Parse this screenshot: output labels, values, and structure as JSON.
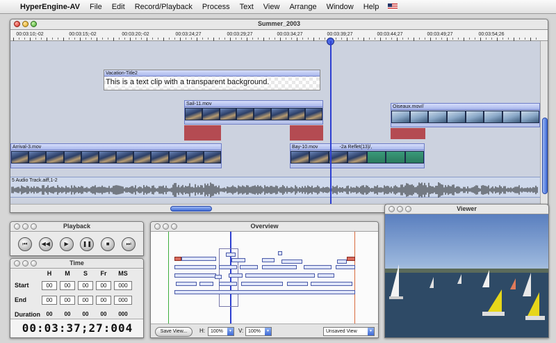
{
  "menubar": {
    "apple_glyph": "",
    "app_name": "HyperEngine-AV",
    "items": [
      "File",
      "Edit",
      "Record/Playback",
      "Process",
      "Text",
      "View",
      "Arrange",
      "Window",
      "Help"
    ]
  },
  "main_window": {
    "title": "Summer_2003",
    "ruler_labels": [
      "00:03:10;-02",
      "00:03:15;-02",
      "00:03:20;-02",
      "00:03:24;27",
      "00:03:29;27",
      "00:03:34;27",
      "00:03:39;27",
      "00:03:44;27",
      "00:03:49;27",
      "00:03:54;26"
    ],
    "text_clip": {
      "name": "Vacation-Title2",
      "text": "This is a text clip with a transparent background."
    },
    "clips": {
      "sail": "Sail-11.mov",
      "oiseaux": "Oiseaux.mov//",
      "arrival": "Arrival-3.mov",
      "bay": "Bay-10.mov",
      "reflet": "-2a Reflet(13)/,"
    },
    "audio_track": "5 Audio Track.aiff,1-2",
    "accent_color": "#2d3fd1"
  },
  "playback": {
    "title": "Playback",
    "buttons": [
      {
        "name": "rewind-to-start",
        "glyph": "⏮"
      },
      {
        "name": "step-back",
        "glyph": "◀◀"
      },
      {
        "name": "play",
        "glyph": "▶"
      },
      {
        "name": "pause",
        "glyph": "❚❚"
      },
      {
        "name": "stop",
        "glyph": "■"
      },
      {
        "name": "forward-to-end",
        "glyph": "⏭"
      }
    ]
  },
  "time": {
    "title": "Time",
    "columns": [
      "H",
      "M",
      "S",
      "Fr",
      "MS"
    ],
    "rows": {
      "start": {
        "label": "Start",
        "values": [
          "00",
          "00",
          "00",
          "00",
          "000"
        ]
      },
      "end": {
        "label": "End",
        "values": [
          "00",
          "00",
          "00",
          "00",
          "000"
        ]
      },
      "duration": {
        "label": "Duration",
        "values": [
          "00",
          "00",
          "00",
          "00",
          "000"
        ]
      }
    },
    "current_time": "00:03:37;27:004"
  },
  "overview": {
    "title": "Overview",
    "save_view_label": "Save View...",
    "h_label": "H:",
    "h_value": "100%",
    "v_label": "V:",
    "v_value": "100%",
    "view_select": "Unsaved View"
  },
  "viewer": {
    "title": "Viewer"
  }
}
